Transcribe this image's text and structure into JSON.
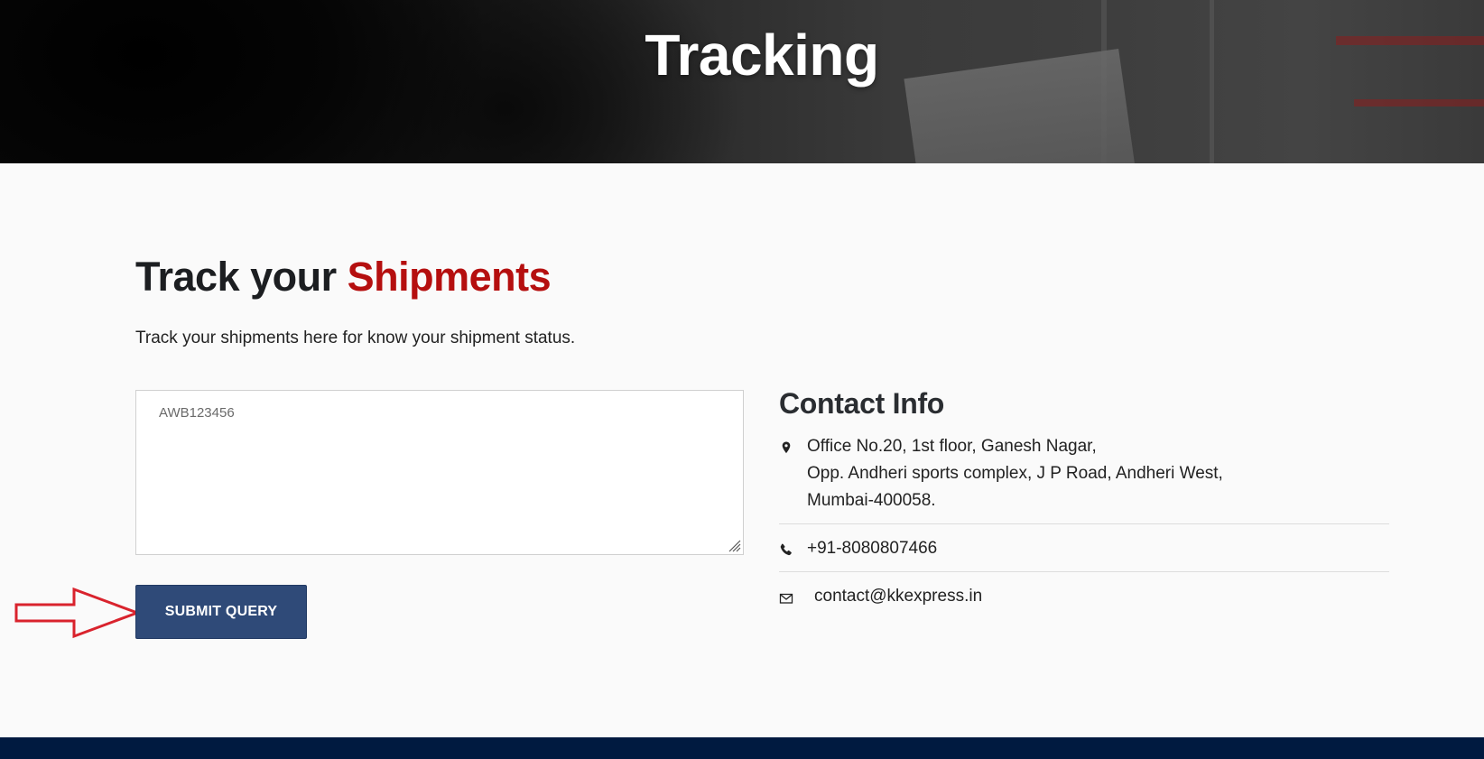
{
  "hero": {
    "title": "Tracking"
  },
  "main": {
    "heading_plain": "Track your ",
    "heading_accent": "Shipments",
    "description": "Track your shipments here for know your shipment status."
  },
  "form": {
    "awb_placeholder": "AWB123456",
    "submit_label": "SUBMIT QUERY"
  },
  "contact": {
    "heading": "Contact Info",
    "address_lines": [
      "Office No.20, 1st floor, Ganesh Nagar,",
      "Opp. Andheri sports complex, J P Road, Andheri West,",
      "Mumbai-400058."
    ],
    "phone": "+91-8080807466",
    "email": "contact@kkexpress.in"
  },
  "icons": {
    "address": "map-marker-icon",
    "phone": "phone-icon",
    "email": "envelope-icon"
  },
  "colors": {
    "accent_red": "#b50f0f",
    "button_navy": "#2f4a78",
    "footer_navy": "#001a40",
    "annotation_red": "#d9232d"
  }
}
